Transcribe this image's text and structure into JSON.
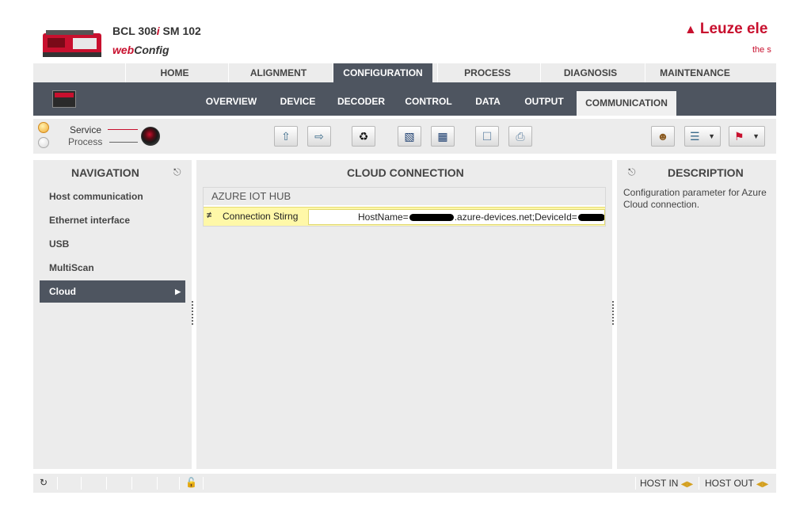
{
  "header": {
    "product_model": "BCL 308",
    "product_model_i": "i",
    "product_variant": " SM 102",
    "app_web": "web",
    "app_config": "Config",
    "brand": "Leuze ele",
    "tagline": "the s"
  },
  "main_tabs": [
    {
      "label": "HOME"
    },
    {
      "label": "ALIGNMENT"
    },
    {
      "label": "CONFIGURATION",
      "active": true
    },
    {
      "label": "PROCESS"
    },
    {
      "label": "DIAGNOSIS"
    },
    {
      "label": "MAINTENANCE"
    }
  ],
  "sub_tabs": [
    {
      "label": "OVERVIEW"
    },
    {
      "label": "DEVICE"
    },
    {
      "label": "DECODER"
    },
    {
      "label": "CONTROL"
    },
    {
      "label": "DATA"
    },
    {
      "label": "OUTPUT"
    },
    {
      "label": "COMMUNICATION",
      "active": true
    }
  ],
  "mode": {
    "service_label": "Service",
    "process_label": "Process",
    "selected": "Service"
  },
  "toolbar_icons": [
    "upload-to-device-icon",
    "download-from-device-icon",
    "recycle-icon",
    "save-to-disk-icon",
    "load-from-disk-icon",
    "export-icon",
    "print-icon",
    "users-icon",
    "settings-dropdown-icon",
    "language-flag-icon"
  ],
  "navigation": {
    "title": "NAVIGATION",
    "items": [
      {
        "label": "Host communication"
      },
      {
        "label": "Ethernet interface"
      },
      {
        "label": "USB"
      },
      {
        "label": "MultiScan"
      },
      {
        "label": "Cloud",
        "active": true
      }
    ]
  },
  "cloud": {
    "title": "CLOUD CONNECTION",
    "group_title": "AZURE IOT HUB",
    "param_icon": "≠",
    "param_label": "Connection Stirng",
    "value_part1": "HostName=",
    "value_part2": ".azure-devices.net;DeviceId="
  },
  "description": {
    "title": "DESCRIPTION",
    "text": "Configuration parameter for Azure Cloud connection."
  },
  "status": {
    "host_in": "HOST IN",
    "host_out": "HOST OUT"
  },
  "colors": {
    "accent_red": "#c8102e",
    "nav_dark": "#4e5560",
    "panel_bg": "#ececec",
    "param_highlight": "#fff8a8"
  }
}
